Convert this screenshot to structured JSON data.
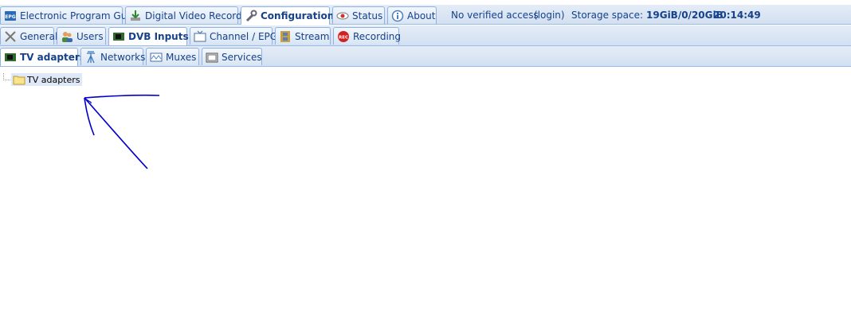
{
  "top_tabs": [
    {
      "label": "Electronic Program Guide",
      "icon": "epg-icon",
      "active": false
    },
    {
      "label": "Digital Video Recorder",
      "icon": "download-icon",
      "active": false
    },
    {
      "label": "Configuration",
      "icon": "wrench-icon",
      "active": true
    },
    {
      "label": "Status",
      "icon": "eye-icon",
      "active": false
    },
    {
      "label": "About",
      "icon": "info-icon",
      "active": false
    }
  ],
  "header_info": {
    "access": "No verified access",
    "login": "(login)",
    "storage_label": "Storage space:",
    "storage_value": "19GiB/0/20GiB",
    "time": "20:14:49"
  },
  "config_tabs": [
    {
      "label": "General",
      "icon": "tools-icon",
      "active": false
    },
    {
      "label": "Users",
      "icon": "users-icon",
      "active": false
    },
    {
      "label": "DVB Inputs",
      "icon": "tv-card-icon",
      "active": true
    },
    {
      "label": "Channel / EPG",
      "icon": "tv-icon",
      "active": false
    },
    {
      "label": "Stream",
      "icon": "film-icon",
      "active": false
    },
    {
      "label": "Recording",
      "icon": "rec-icon",
      "active": false
    }
  ],
  "dvb_tabs": [
    {
      "label": "TV adapters",
      "icon": "tv-card-icon",
      "active": true
    },
    {
      "label": "Networks",
      "icon": "antenna-icon",
      "active": false
    },
    {
      "label": "Muxes",
      "icon": "signal-icon",
      "active": false
    },
    {
      "label": "Services",
      "icon": "tv-small-icon",
      "active": false
    }
  ],
  "tree": {
    "root_label": "TV adapters",
    "icon": "folder-icon"
  },
  "colors": {
    "accent": "#15428b",
    "tab_border": "#8db2e3",
    "annotation": "#0000cc"
  }
}
